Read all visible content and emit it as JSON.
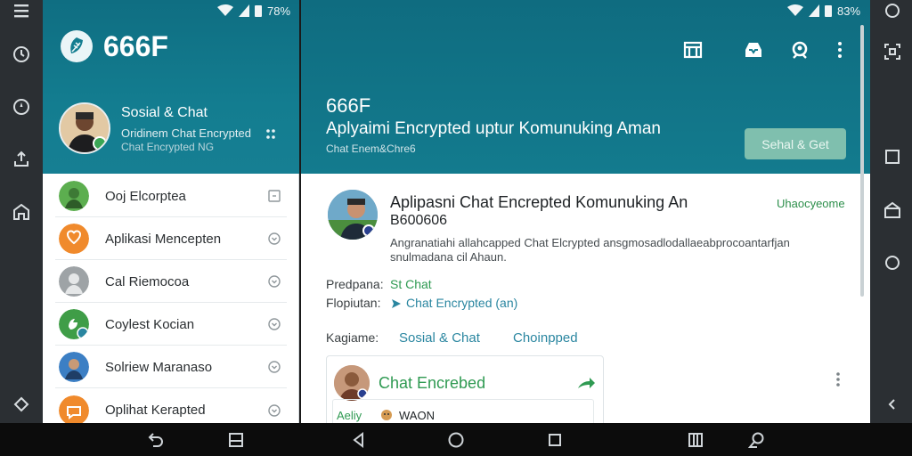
{
  "status_bar": {
    "left_battery": "78%",
    "right_battery": "83%"
  },
  "sidebar": {
    "app_title": "666F",
    "profile": {
      "name": "Sosial & Chat",
      "subtitle": "Oridinem Chat Encrypted",
      "caption": "Chat Encrypted  NG"
    },
    "chats": [
      {
        "name": "Ooj Elcorptea",
        "color": "#5cae4f"
      },
      {
        "name": "Aplikasi Mencepten",
        "color": "#f08a2c"
      },
      {
        "name": "Cal Riemocoa",
        "color": "#9ea3a6"
      },
      {
        "name": "Coylest Kocian",
        "color": "#3f9d47"
      },
      {
        "name": "Solriew Maranaso",
        "color": "#3c7fc4"
      },
      {
        "name": "Oplihat Kerapted",
        "color": "#f08a2c"
      }
    ]
  },
  "header": {
    "title": "666F",
    "subtitle": "Aplyaimi Encrypted uptur Komunuking Aman",
    "caption": "Chat Enem&Chre6",
    "action_label": "Sehal & Get"
  },
  "post": {
    "title": "Aplipasni Chat Encrepted Komunuking An",
    "title2": "B600606",
    "badge": "Uhaocyeome",
    "description": "Angranatiahi allahcapped Chat Elcrypted ansgmosadlodallaeabprocoantarfjan snulmadana cil Ahaun.",
    "meta": [
      {
        "label": "Predpana:",
        "value": "St Chat",
        "color": "#2f9a52"
      },
      {
        "label": "Flopiutan:",
        "value": "Chat Encrypted (an)",
        "color": "#2a86a0"
      }
    ],
    "tags_label": "Kagiame:",
    "tags": [
      "Sosial & Chat",
      "Choinpped"
    ]
  },
  "card": {
    "title": "Chat Encrebed",
    "inner_tag": "Aeliy",
    "inner_text": "WAON"
  }
}
